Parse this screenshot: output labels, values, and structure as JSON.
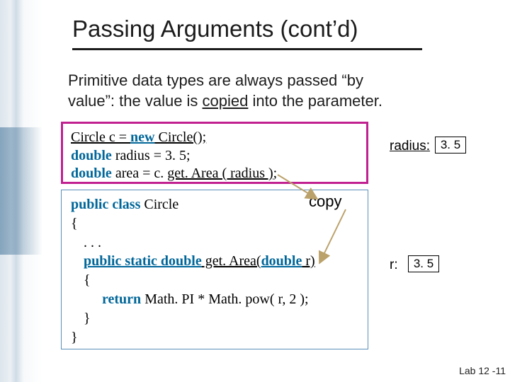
{
  "title": "Passing Arguments (cont’d)",
  "body": {
    "line1": "Primitive data types are always passed “by",
    "line2_a": "value”: the value is ",
    "line2_copied": "copied",
    "line2_b": " into the parameter."
  },
  "code_top": {
    "l1_a": "Circle c = ",
    "l1_new": "new",
    "l1_b": " Circle();",
    "l2_kw": "double",
    "l2_b": " radius = 3. 5;",
    "l3_kw": "double",
    "l3_b": " area = c. ",
    "l3_call": "get. Area ( radius )",
    "l3_c": ";"
  },
  "code_bottom": {
    "l1_a": "public class",
    "l1_b": " Circle",
    "l2": "{",
    "l3": ". . .",
    "l4_a": "public static double",
    "l4_m": " get. Area(",
    "l4_kw2": "double",
    "l4_c": " r)",
    "l5": "{",
    "l6_a": "return",
    "l6_b": " Math. PI * Math. pow( r, 2 );",
    "l7": "}",
    "l8": "}"
  },
  "labels": {
    "copy": "copy",
    "radius": "radius:",
    "radius_val": "3. 5",
    "r": "r:",
    "r_val": "3. 5"
  },
  "footer": "Lab 12 -11"
}
